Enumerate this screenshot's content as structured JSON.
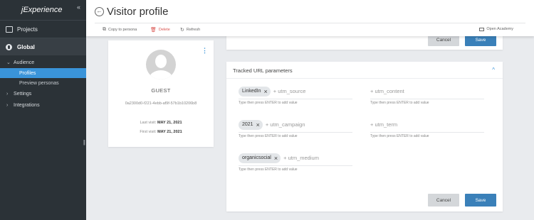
{
  "sidebar": {
    "brand": "jExperience",
    "collapse_icon": "«",
    "projects_label": "Projects",
    "global_label": "Global",
    "audience_label": "Audience",
    "profiles_label": "Profiles",
    "preview_personas_label": "Preview personas",
    "settings_label": "Settings",
    "integrations_label": "Integrations",
    "drag_handle": "||"
  },
  "header": {
    "title": "Visitor profile",
    "copy_label": "Copy to persona",
    "delete_label": "Delete",
    "refresh_label": "Refresh",
    "academy_label": "Open Academy"
  },
  "profile": {
    "name": "GUEST",
    "id": "0a2300d0-f221-4ebb-af9f-57b1b10206b8",
    "last_visit_label": "Last visit:",
    "last_visit_value": "MAY 21, 2021",
    "first_visit_label": "First visit:",
    "first_visit_value": "MAY 21, 2021"
  },
  "top_panel": {
    "cancel_label": "Cancel",
    "save_label": "Save"
  },
  "url_panel": {
    "title": "Tracked URL parameters",
    "hint": "Type then press ENTER to add value",
    "fields": [
      {
        "chip": "LinkedIn",
        "placeholder": "+ utm_source"
      },
      {
        "chip": "",
        "placeholder": "+ utm_content"
      },
      {
        "chip": "2021",
        "placeholder": "+ utm_campaign"
      },
      {
        "chip": "",
        "placeholder": "+ utm_term"
      },
      {
        "chip": "organicsocial",
        "placeholder": "+ utm_medium"
      }
    ],
    "cancel_label": "Cancel",
    "save_label": "Save"
  },
  "colors": {
    "sidebar_bg": "#2b3237",
    "active_item": "#3a94d9",
    "save_button": "#3a80b9",
    "delete_text": "#d9534f"
  }
}
